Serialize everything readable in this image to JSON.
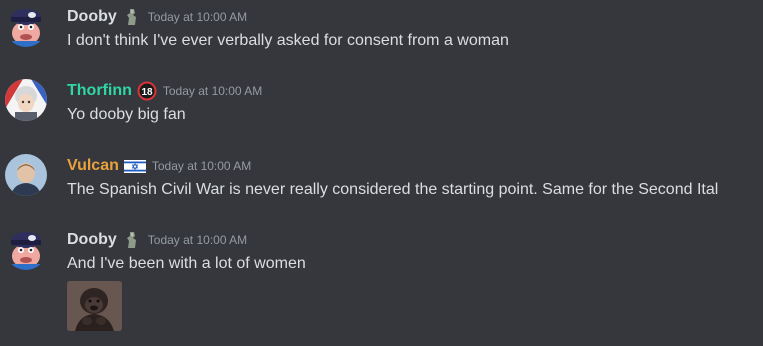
{
  "messages": [
    {
      "username": "Dooby",
      "username_color": "#dbdee1",
      "role_icon": "statue-icon",
      "timestamp": "Today at 10:00 AM",
      "text": "I don't think I've ever verbally asked for consent from a woman"
    },
    {
      "username": "Thorfinn",
      "username_color": "#2fd7a4",
      "role_icon": "age-18-badge-icon",
      "role_icon_text": "18",
      "timestamp": "Today at 10:00 AM",
      "text": "Yo dooby big fan"
    },
    {
      "username": "Vulcan",
      "username_color": "#e9a23b",
      "role_icon": "israel-flag-icon",
      "timestamp": "Today at 10:00 AM",
      "text": "The Spanish Civil War is never really considered the starting point. Same for the Second Ital"
    },
    {
      "username": "Dooby",
      "username_color": "#dbdee1",
      "role_icon": "statue-icon",
      "timestamp": "Today at 10:00 AM",
      "text": "And I've been with a lot of women",
      "attachment": "gorilla-image"
    }
  ]
}
